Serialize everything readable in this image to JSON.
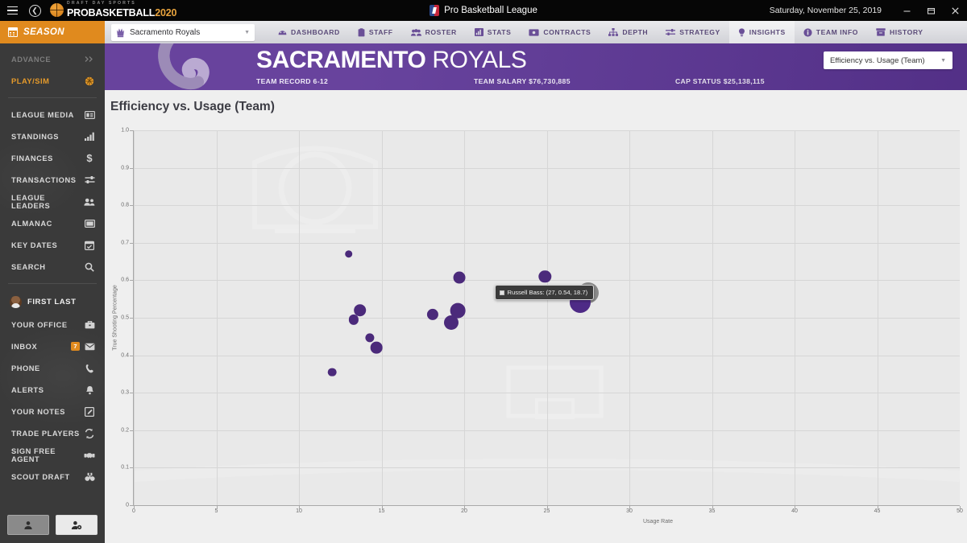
{
  "titlebar": {
    "brand_top": "DRAFT DAY SPORTS",
    "brand_main": "PROBASKETBALL",
    "brand_year": "2020",
    "app_title": "Pro Basketball League",
    "date": "Saturday, November 25, 2019",
    "minimize": "—",
    "restore": "❐",
    "close": "✕"
  },
  "sidebar": {
    "season_label": "SEASON",
    "top_items": [
      {
        "label": "ADVANCE",
        "icon": "chevrons-right-icon",
        "state": "dim"
      },
      {
        "label": "PLAY/SIM",
        "icon": "basketball-icon",
        "state": "accent"
      }
    ],
    "league_items": [
      {
        "label": "LEAGUE MEDIA",
        "icon": "newspaper-icon"
      },
      {
        "label": "STANDINGS",
        "icon": "bar-chart-icon"
      },
      {
        "label": "FINANCES",
        "icon": "dollar-icon"
      },
      {
        "label": "TRANSACTIONS",
        "icon": "sliders-icon"
      },
      {
        "label": "LEAGUE LEADERS",
        "icon": "people-icon"
      },
      {
        "label": "ALMANAC",
        "icon": "book-icon"
      },
      {
        "label": "KEY DATES",
        "icon": "calendar-check-icon"
      },
      {
        "label": "SEARCH",
        "icon": "search-icon"
      }
    ],
    "user_name": "FIRST LAST",
    "user_items": [
      {
        "label": "YOUR OFFICE",
        "icon": "briefcase-icon",
        "badge": ""
      },
      {
        "label": "INBOX",
        "icon": "envelope-icon",
        "badge": "7"
      },
      {
        "label": "PHONE",
        "icon": "phone-icon",
        "badge": ""
      },
      {
        "label": "ALERTS",
        "icon": "bell-icon",
        "badge": ""
      },
      {
        "label": "YOUR NOTES",
        "icon": "note-edit-icon",
        "badge": ""
      },
      {
        "label": "TRADE PLAYERS",
        "icon": "exchange-icon",
        "badge": ""
      },
      {
        "label": "SIGN FREE AGENT",
        "icon": "handshake-icon",
        "badge": ""
      },
      {
        "label": "SCOUT DRAFT",
        "icon": "binoculars-icon",
        "badge": ""
      }
    ]
  },
  "navbar": {
    "team_selected": "Sacramento Royals",
    "items": [
      {
        "label": "DASHBOARD",
        "icon": "speedometer-icon",
        "active": false
      },
      {
        "label": "STAFF",
        "icon": "clipboard-icon",
        "active": false
      },
      {
        "label": "ROSTER",
        "icon": "people-icon",
        "active": false
      },
      {
        "label": "STATS",
        "icon": "bar-chart-icon",
        "active": false
      },
      {
        "label": "CONTRACTS",
        "icon": "money-icon",
        "active": false
      },
      {
        "label": "DEPTH",
        "icon": "hierarchy-icon",
        "active": false
      },
      {
        "label": "STRATEGY",
        "icon": "sliders-icon",
        "active": false
      },
      {
        "label": "INSIGHTS",
        "icon": "lightbulb-icon",
        "active": true
      },
      {
        "label": "TEAM INFO",
        "icon": "info-icon",
        "active": false
      },
      {
        "label": "HISTORY",
        "icon": "archive-icon",
        "active": false
      }
    ]
  },
  "banner": {
    "city": "SACRAMENTO",
    "nickname": "ROYALS",
    "record": "TEAM RECORD 6-12",
    "salary": "TEAM SALARY $76,730,885",
    "cap": "CAP STATUS $25,138,115",
    "chart_selector": "Efficiency vs. Usage (Team)",
    "accent_color": "#5c3596"
  },
  "panel": {
    "title": "Efficiency vs. Usage (Team)"
  },
  "tooltip": {
    "visible": true,
    "text": "Russell Bass: (27, 0.54, 18.7)"
  },
  "chart_data": {
    "type": "scatter",
    "title": "Efficiency vs. Usage (Team)",
    "xlabel": "Usage Rate",
    "ylabel": "True Shooting Percentage",
    "xlim": [
      0,
      50
    ],
    "ylim": [
      0,
      1.0
    ],
    "xticks": [
      0,
      5,
      10,
      15,
      20,
      25,
      30,
      35,
      40,
      45,
      50
    ],
    "ytick_labels": [
      "0",
      "0.1",
      "0.2",
      "0.3",
      "0.4",
      "0.5",
      "0.6",
      "0.7",
      "0.8",
      "0.9",
      "1.0"
    ],
    "yticks": [
      0,
      0.1,
      0.2,
      0.3,
      0.4,
      0.5,
      0.6,
      0.7,
      0.8,
      0.9,
      1.0
    ],
    "grid": true,
    "legend": "none",
    "bubble_size_meaning": "Minutes per game",
    "point_color": "#4b2a7b",
    "highlight_color": "#8a8a8a",
    "points": [
      {
        "label": "",
        "x": 13.0,
        "y": 0.67,
        "size": 1.2
      },
      {
        "label": "",
        "x": 12.0,
        "y": 0.355,
        "size": 1.7
      },
      {
        "label": "",
        "x": 14.3,
        "y": 0.447,
        "size": 2.0
      },
      {
        "label": "",
        "x": 13.3,
        "y": 0.495,
        "size": 2.6
      },
      {
        "label": "",
        "x": 13.7,
        "y": 0.52,
        "size": 5.2
      },
      {
        "label": "",
        "x": 14.7,
        "y": 0.42,
        "size": 4.4
      },
      {
        "label": "",
        "x": 18.1,
        "y": 0.509,
        "size": 4.0
      },
      {
        "label": "",
        "x": 19.2,
        "y": 0.487,
        "size": 7.6
      },
      {
        "label": "",
        "x": 19.6,
        "y": 0.519,
        "size": 8.4
      },
      {
        "label": "",
        "x": 19.7,
        "y": 0.608,
        "size": 4.6
      },
      {
        "label": "",
        "x": 24.9,
        "y": 0.61,
        "size": 5.0
      },
      {
        "label": "Russell Bass",
        "x": 27.0,
        "y": 0.54,
        "size": 18.7
      }
    ]
  }
}
